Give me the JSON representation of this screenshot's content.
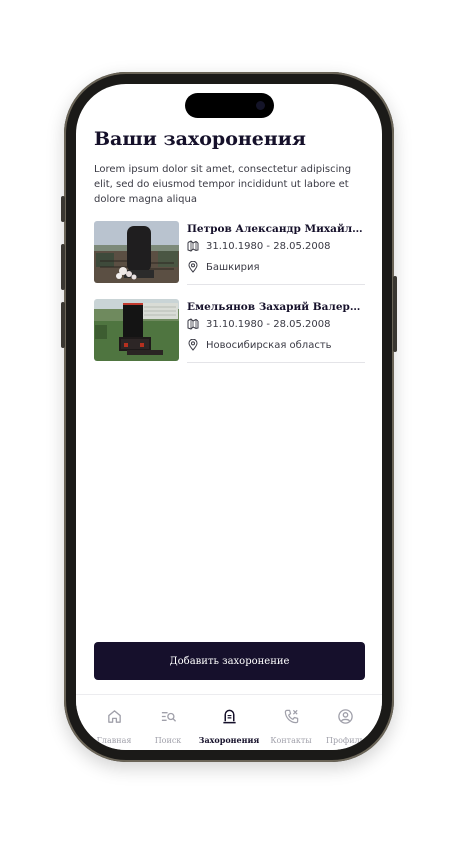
{
  "screen": {
    "title": "Ваши захоронения",
    "intro": "Lorem ipsum dolor sit amet, consectetur adipiscing elit, sed do eiusmod tempor incididunt ut labore et dolore magna aliqua"
  },
  "burials": [
    {
      "name": "Петров Александр Михайлович",
      "dates": "31.10.1980 - 28.05.2008",
      "location": "Башкирия"
    },
    {
      "name": "Емельянов Захарий Валерьевич",
      "dates": "31.10.1980 - 28.05.2008",
      "location": "Новосибирская область"
    }
  ],
  "actions": {
    "add_label": "Добавить захоронение"
  },
  "tabs": [
    {
      "label": "Главная",
      "icon": "home-icon",
      "active": false
    },
    {
      "label": "Поиск",
      "icon": "search-list-icon",
      "active": false
    },
    {
      "label": "Захоронения",
      "icon": "tombstone-icon",
      "active": true
    },
    {
      "label": "Контакты",
      "icon": "phone-icon",
      "active": false
    },
    {
      "label": "Профиль",
      "icon": "profile-icon",
      "active": false
    }
  ],
  "colors": {
    "accent": "#16102C",
    "inactive_tab": "#A0A0AA"
  }
}
